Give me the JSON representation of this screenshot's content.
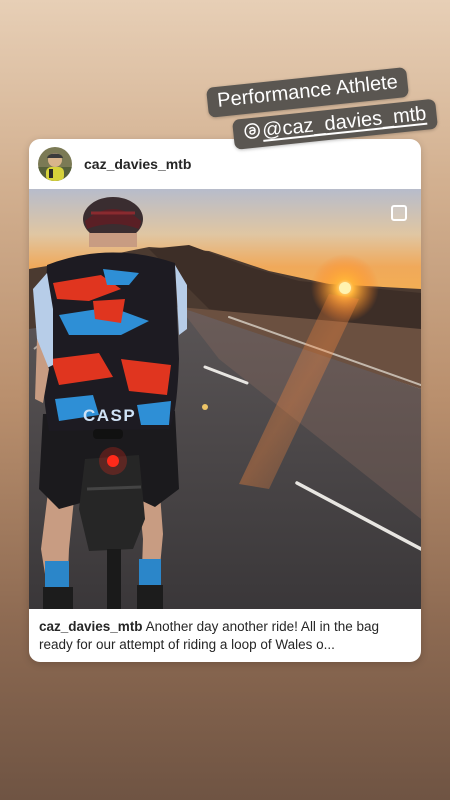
{
  "sticker": {
    "line1": "Performance Athlete",
    "handle": "@caz_davies_mtb",
    "icon": "threads-icon"
  },
  "post": {
    "username": "caz_davies_mtb",
    "caption_user": "caz_davies_mtb",
    "caption_text": "Another day another ride! All in the bag ready for our attempt of riding a loop of Wales o...",
    "jersey_text": "CASP"
  },
  "colors": {
    "sticker_bg": "#5a5651",
    "card_bg": "#ffffff",
    "text": "#262626"
  }
}
